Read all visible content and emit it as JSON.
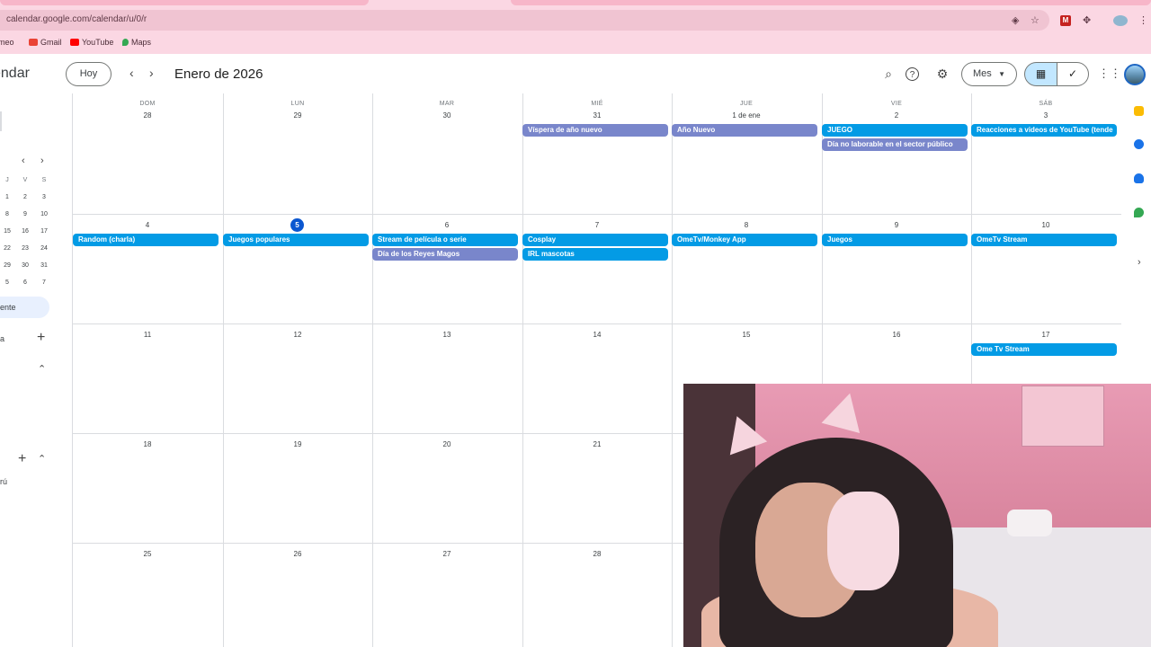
{
  "browser": {
    "url": "calendar.google.com/calendar/u/0/r",
    "bookmarks": [
      {
        "label": "meo",
        "color": "#5f3a47"
      },
      {
        "label": "Gmail",
        "color": "#ea4335"
      },
      {
        "label": "YouTube",
        "color": "#ff0000"
      },
      {
        "label": "Maps",
        "color": "#34a853"
      }
    ]
  },
  "header": {
    "app_name": "endar",
    "today_label": "Hoy",
    "prev_icon": "chevron-left-icon",
    "next_icon": "chevron-right-icon",
    "month_title": "Enero de 2026",
    "view_label": "Mes",
    "accent": "#c2e7ff"
  },
  "sidebar": {
    "mini_calendar": {
      "dow": [
        "J",
        "V",
        "S"
      ],
      "rows": [
        [
          "1",
          "2",
          "3"
        ],
        [
          "8",
          "9",
          "10"
        ],
        [
          "15",
          "16",
          "17"
        ],
        [
          "22",
          "23",
          "24"
        ],
        [
          "29",
          "30",
          "31"
        ],
        [
          "5",
          "6",
          "7"
        ]
      ]
    },
    "active_item": "ente",
    "section_a": "a",
    "section_b": "rú"
  },
  "calendar": {
    "weekdays": [
      "DOM",
      "LUN",
      "MAR",
      "MIÉ",
      "JUE",
      "VIE",
      "SÁB"
    ],
    "weeks": [
      [
        "28",
        "29",
        "30",
        "31",
        "1 de ene",
        "2",
        "3"
      ],
      [
        "4",
        "5",
        "6",
        "7",
        "8",
        "9",
        "10"
      ],
      [
        "11",
        "12",
        "13",
        "14",
        "15",
        "16",
        "17"
      ],
      [
        "18",
        "19",
        "20",
        "21",
        "22",
        "23",
        "24"
      ],
      [
        "25",
        "26",
        "27",
        "28",
        "29",
        "30",
        "31"
      ]
    ],
    "today": "5",
    "events": [
      {
        "week": 0,
        "day": 3,
        "slot": 0,
        "title": "Víspera de año nuevo",
        "color": "#7986cb"
      },
      {
        "week": 0,
        "day": 4,
        "slot": 0,
        "title": "Año Nuevo",
        "color": "#7986cb"
      },
      {
        "week": 0,
        "day": 5,
        "slot": 0,
        "title": "JUEGO",
        "color": "#039be5"
      },
      {
        "week": 0,
        "day": 5,
        "slot": 1,
        "title": "Día no laborable en el sector público",
        "color": "#7986cb"
      },
      {
        "week": 0,
        "day": 6,
        "slot": 0,
        "title": "Reacciones a videos de YouTube (tende",
        "color": "#039be5"
      },
      {
        "week": 1,
        "day": 0,
        "slot": 0,
        "title": "Random (charla)",
        "color": "#039be5"
      },
      {
        "week": 1,
        "day": 1,
        "slot": 0,
        "title": "Juegos populares",
        "color": "#039be5"
      },
      {
        "week": 1,
        "day": 2,
        "slot": 0,
        "title": "Stream de película o serie",
        "color": "#039be5"
      },
      {
        "week": 1,
        "day": 2,
        "slot": 1,
        "title": "Día de los Reyes Magos",
        "color": "#7986cb"
      },
      {
        "week": 1,
        "day": 3,
        "slot": 0,
        "title": "Cosplay",
        "color": "#039be5"
      },
      {
        "week": 1,
        "day": 3,
        "slot": 1,
        "title": "IRL mascotas",
        "color": "#039be5"
      },
      {
        "week": 1,
        "day": 4,
        "slot": 0,
        "title": "OmeTv/Monkey App",
        "color": "#039be5"
      },
      {
        "week": 1,
        "day": 5,
        "slot": 0,
        "title": "Juegos",
        "color": "#039be5"
      },
      {
        "week": 1,
        "day": 6,
        "slot": 0,
        "title": "OmeTv Stream",
        "color": "#039be5"
      },
      {
        "week": 2,
        "day": 6,
        "slot": 0,
        "title": "Ome Tv Stream",
        "color": "#039be5"
      }
    ]
  },
  "overlay": {
    "type": "webcam-feed",
    "wall_color": "#e89bb4"
  }
}
